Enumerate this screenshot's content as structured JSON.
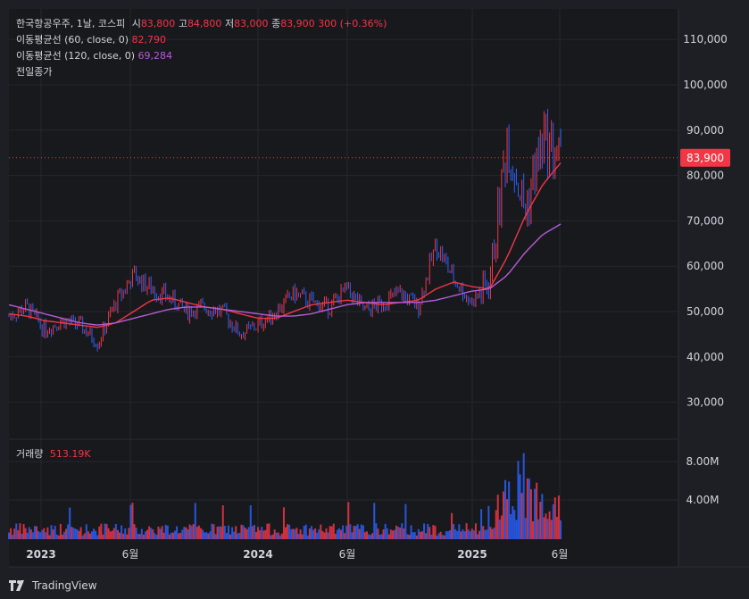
{
  "legend": {
    "symbol": "한국항공우주, 1날, 코스피",
    "open_label": "시",
    "open": "83,800",
    "high_label": "고",
    "high": "84,800",
    "low_label": "저",
    "low": "83,000",
    "close_label": "종",
    "close": "83,900",
    "change": "300 (+0.36%)",
    "ma60_label": "이동평균선 (60, close, 0)",
    "ma60_value": "82,790",
    "ma120_label": "이동평균선 (120, close, 0)",
    "ma120_value": "69,284",
    "prev_close_label": "전일종가"
  },
  "volume_legend": {
    "label": "거래량",
    "value": "513.19K"
  },
  "last_price_tag": "83,900",
  "watermark": {
    "icon": "tradingview-logo-icon",
    "text": "TradingView"
  },
  "colors": {
    "background": "#1e1f24",
    "up": "#f23645",
    "down": "#2962ff",
    "ma60": "#f23645",
    "ma120": "#b55cd6",
    "text": "#d1d4dc"
  },
  "chart_data": {
    "type": "line",
    "x_tick_labels": [
      "2023",
      "6월",
      "2024",
      "6월",
      "2025",
      "6월"
    ],
    "price_axis": {
      "ticks": [
        "110,000",
        "100,000",
        "90,000",
        "80,000",
        "70,000",
        "60,000",
        "50,000",
        "40,000",
        "30,000"
      ],
      "ylim": [
        20000,
        115000
      ]
    },
    "volume_axis": {
      "ticks": [
        "8.00M",
        "4.00M"
      ]
    },
    "series": [
      {
        "name": "한국항공우주",
        "x": [
          "2022-11",
          "2022-12",
          "2023-01",
          "2023-02",
          "2023-03",
          "2023-04",
          "2023-05",
          "2023-06",
          "2023-07",
          "2023-08",
          "2023-09",
          "2023-10",
          "2023-11",
          "2023-12",
          "2024-01",
          "2024-02",
          "2024-03",
          "2024-04",
          "2024-05",
          "2024-06",
          "2024-07",
          "2024-08",
          "2024-09",
          "2024-10",
          "2024-11",
          "2024-12",
          "2025-01",
          "2025-02",
          "2025-03",
          "2025-04",
          "2025-05",
          "2025-06"
        ],
        "values": [
          49000,
          51000,
          46000,
          48000,
          47000,
          43000,
          52000,
          58000,
          55000,
          53000,
          50000,
          51000,
          50000,
          45000,
          47000,
          50000,
          54000,
          52000,
          51000,
          55000,
          50000,
          52000,
          54000,
          51000,
          65000,
          57000,
          52000,
          56000,
          88000,
          72000,
          88000,
          83900
        ]
      },
      {
        "name": "이동평균선 (60, close, 0)",
        "values": [
          49500,
          49000,
          48000,
          47500,
          47000,
          46500,
          47500,
          50000,
          52500,
          53000,
          52000,
          51000,
          50500,
          49500,
          48500,
          48500,
          50000,
          51500,
          52000,
          52500,
          52000,
          51500,
          52000,
          52500,
          55000,
          56500,
          55500,
          55000,
          62000,
          71000,
          78000,
          82790
        ]
      },
      {
        "name": "이동평균선 (120, close, 0)",
        "values": [
          51500,
          50500,
          49500,
          48500,
          47500,
          47000,
          47500,
          48500,
          49500,
          50500,
          51000,
          51000,
          50500,
          50000,
          49500,
          49000,
          49000,
          49500,
          50500,
          51500,
          52000,
          52000,
          52000,
          52000,
          52500,
          53500,
          54500,
          55000,
          58000,
          63000,
          67000,
          69284
        ]
      }
    ],
    "volume_peak_values": [
      "8.00M",
      "4.00M"
    ]
  }
}
